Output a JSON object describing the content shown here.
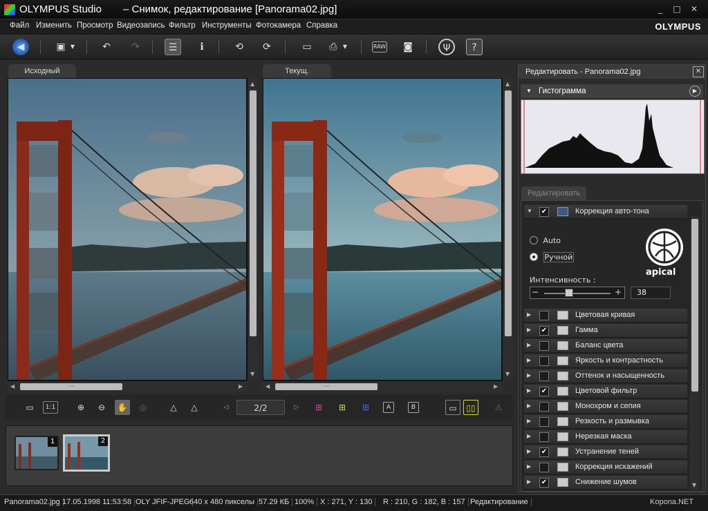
{
  "window": {
    "app_name": "OLYMPUS Studio",
    "doc_title": "– Снимок, редактирование [Panorama02.jpg]",
    "brand": "OLYMPUS"
  },
  "menu": [
    "Файл",
    "Изменить",
    "Просмотр",
    "Видеозапись",
    "Фильтр",
    "Инструменты",
    "Фотокамера",
    "Справка"
  ],
  "panes": {
    "left_tab": "Исходный",
    "right_tab": "Текущ.",
    "hscroll_label": "···"
  },
  "navigation": {
    "page": "2/2",
    "one_to_one": "1:1"
  },
  "filmstrip": [
    {
      "number": "1"
    },
    {
      "number": "2"
    }
  ],
  "right_panel": {
    "title": "Редактировать - Panorama02.jpg",
    "histogram_title": "Гистограмма",
    "edit_tab": "Редактировать",
    "auto_tone": {
      "title": "Коррекция авто-тона",
      "option_auto": "Auto",
      "option_manual": "Ручной",
      "intensity_label": "Интенсивность :",
      "intensity_value": "38",
      "intensity_fraction": 0.38,
      "logo_text": "apical"
    },
    "items": [
      {
        "label": "Цветовая кривая",
        "checked": false
      },
      {
        "label": "Гамма",
        "checked": true
      },
      {
        "label": "Баланс цвета",
        "checked": false
      },
      {
        "label": "Яркость и контрастность",
        "checked": false
      },
      {
        "label": "Оттенок и насыщенность",
        "checked": false
      },
      {
        "label": "Цветовой фильтр",
        "checked": true
      },
      {
        "label": "Монохром и сепия",
        "checked": false
      },
      {
        "label": "Резкость и размывка",
        "checked": false
      },
      {
        "label": "Нерезкая маска",
        "checked": false
      },
      {
        "label": "Устранение теней",
        "checked": true
      },
      {
        "label": "Коррекция искажений",
        "checked": false
      },
      {
        "label": "Снижение шумов",
        "checked": true
      }
    ]
  },
  "status": {
    "file": "Panorama02.jpg",
    "date": "17.05.1998 11:53:58",
    "format": "OLY JFIF-JPEG",
    "dimensions": "640 x 480 пикселы",
    "size": "57.29 КБ",
    "zoom": "100%",
    "coords": "X : 271, Y : 130",
    "rgb": "R : 210, G : 182, B : 157",
    "mode": "Редактирование",
    "watermark": "Kopona.NET"
  },
  "colors": {
    "accent_yellow": "#d8d020",
    "bridge_red": "#8a2a1a"
  }
}
